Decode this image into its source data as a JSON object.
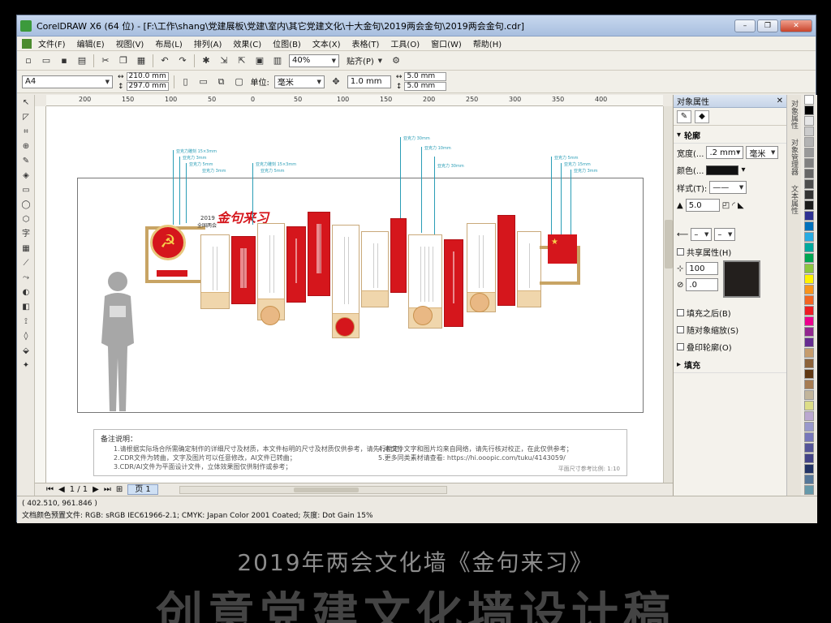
{
  "window": {
    "title": "CorelDRAW X6 (64 位) - [F:\\工作\\shang\\党建展板\\党建\\室内\\其它党建文化\\十大金句\\2019两会金句\\2019两会金句.cdr]",
    "min": "–",
    "max": "❐",
    "close": "✕"
  },
  "menu": [
    "文件(F)",
    "编辑(E)",
    "视图(V)",
    "布局(L)",
    "排列(A)",
    "效果(C)",
    "位图(B)",
    "文本(X)",
    "表格(T)",
    "工具(O)",
    "窗口(W)",
    "帮助(H)"
  ],
  "toolbar": {
    "zoom": "40%",
    "snap": "贴齐(P)"
  },
  "propbar": {
    "page_size": "A4",
    "width": "210.0 mm",
    "height": "297.0 mm",
    "units_label": "单位:",
    "units": "毫米",
    "nudge": "1.0 mm",
    "dup_x": "5.0 mm",
    "dup_y": "5.0 mm"
  },
  "ruler": {
    "h_ticks": [
      "200",
      "150",
      "100",
      "50",
      "0",
      "50",
      "100",
      "150",
      "200",
      "250",
      "300",
      "350",
      "400"
    ]
  },
  "pagebar": {
    "pages": "1 / 1",
    "tab": "页 1"
  },
  "docker": {
    "title": "对象属性",
    "outline_title": "轮廓",
    "width_label": "宽度(...",
    "width_value": ".2 mm",
    "width_unit": "毫米",
    "color_label": "颜色(...",
    "style_label": "样式(T):",
    "miter": "5.0",
    "share": "共享属性(H)",
    "stretch": "100",
    "angle": ".0",
    "fill_behind": "填充之后(B)",
    "scale": "随对象缩放(S)",
    "overprint": "叠印轮廓(O)",
    "fill_title": "填充",
    "vtabs": [
      "对象属性",
      "对象管理器",
      "文本属性"
    ]
  },
  "palette": [
    "#ffffff",
    "#000000",
    "#e6e6e6",
    "#cccccc",
    "#b3b3b3",
    "#999999",
    "#808080",
    "#666666",
    "#4d4d4d",
    "#333333",
    "#1a1a1a",
    "#2e3192",
    "#0071bc",
    "#29abe2",
    "#00a99d",
    "#00a651",
    "#8dc63f",
    "#fff200",
    "#f7941d",
    "#f26522",
    "#ed1c24",
    "#ec008c",
    "#92278f",
    "#662d91",
    "#c69c6d",
    "#8c6239",
    "#603813",
    "#a67c52",
    "#c2b59b",
    "#dddd88",
    "#bba8d0",
    "#9999cc",
    "#7777bb",
    "#555599",
    "#444488",
    "#223366",
    "#557799",
    "#6699aa",
    "#88aabb",
    "#aaccdd"
  ],
  "status": {
    "coords": "( 402.510, 961.846 )",
    "profile": "文档颜色预置文件: RGB: sRGB IEC61966-2.1; CMYK: Japan Color 2001 Coated; 灰度: Dot Gain 15%"
  },
  "canvas": {
    "heading_year": "2019",
    "heading_sub": "全国两会",
    "heading_main": "金句来习",
    "note_title": "备注说明：",
    "note_left": [
      "1.请根据实际场合所需确定制作的详细尺寸及材质，本文件标明的尺寸及材质仅供参考，请先行勘定；",
      "2.CDR文件为转曲，文字及图片可以任意修改，AI文件已转曲；",
      "3.CDR/AI文件为平面设计文件，立体效果图仅供制作或参考；"
    ],
    "note_right": [
      "4.本文件文字和图片均来自网络，请先行核对校正，在此仅供参考；",
      "5.更多同类素材请查看: https://hi.ooopic.com/tuku/4143059/"
    ],
    "note_scale": "平面尺寸参考比例: 1:10",
    "leaders": [
      "亚克力雕刻 15×3mm",
      "亚克力 3mm",
      "亚克力 5mm",
      "亚克力 3mm",
      "亚克力雕刻 15×3mm",
      "亚克力 5mm",
      "亚克力 30mm",
      "亚克力 10mm",
      "亚克力 30mm",
      "亚克力 5mm",
      "亚克力 15mm",
      "亚克力 3mm"
    ]
  },
  "caption": "2019年两会文化墙《金句来习》",
  "big_title": "创意党建文化墙设计稿"
}
